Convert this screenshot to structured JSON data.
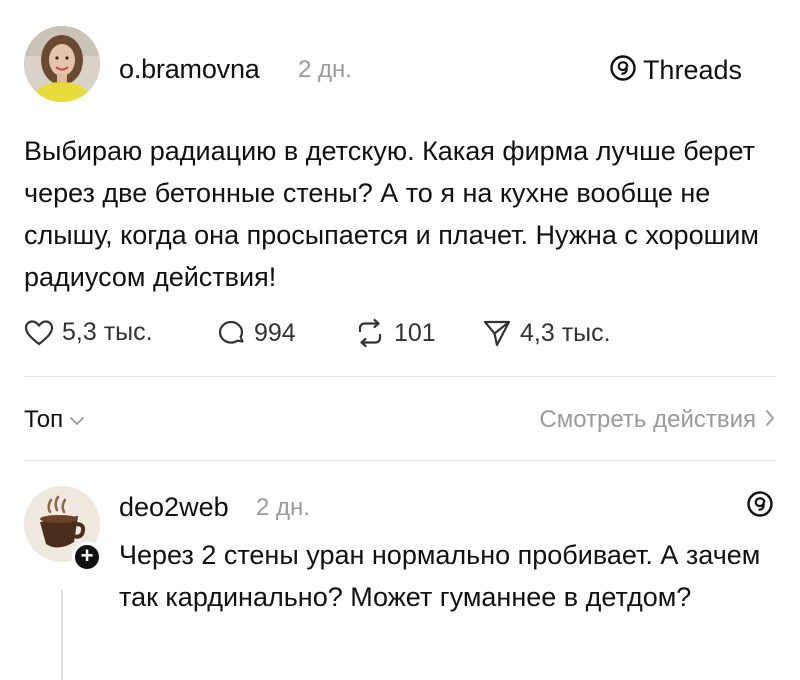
{
  "post": {
    "username": "o.bramovna",
    "time": "2 дн.",
    "brand": "Threads",
    "text": "Выбираю радиацию в детскую. Какая фирма лучше берет через две бетонные стены? А то я на кухне вообще не слышу, когда она просыпается и плачет. Нужна с хорошим радиусом действия!",
    "likes": "5,3 тыс.",
    "comments": "994",
    "reposts": "101",
    "shares": "4,3 тыс."
  },
  "sort": {
    "label": "Топ",
    "view_actions": "Смотреть действия"
  },
  "reply": {
    "username": "deo2web",
    "time": "2 дн.",
    "text": "Через 2 стены уран нормально пробивает. А зачем так кардинально? Может гуманнее в детдом?",
    "follow": "+"
  },
  "icons": {
    "threads": "threads-logo-icon",
    "like": "heart-icon",
    "comment": "comment-bubble-icon",
    "repost": "repost-icon",
    "share": "send-icon",
    "chevron_down": "chevron-down-icon",
    "chevron_right": "chevron-right-icon"
  },
  "colors": {
    "text": "#111111",
    "muted": "#9a9a9a",
    "divider": "#e4e4e4"
  }
}
